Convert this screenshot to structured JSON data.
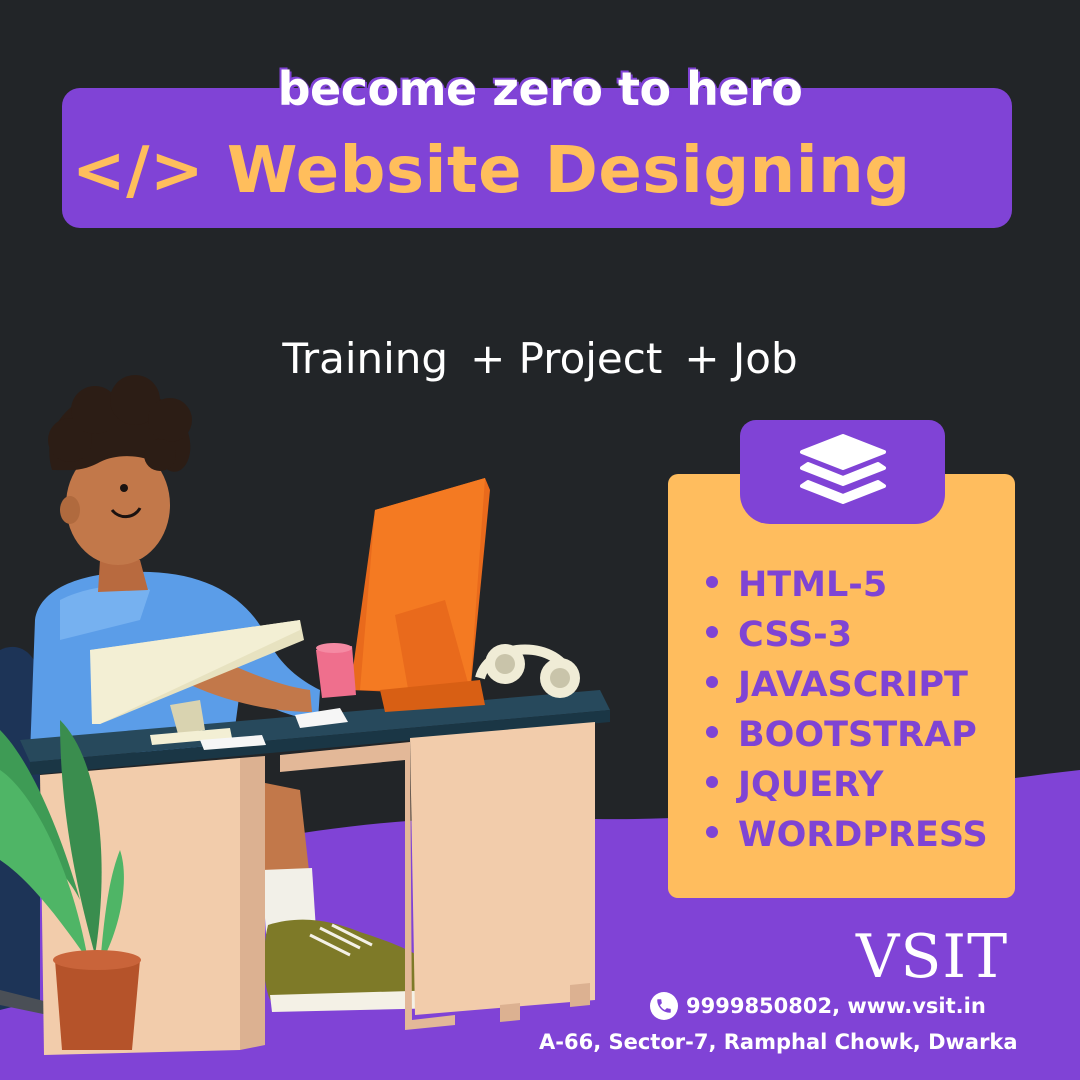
{
  "colors": {
    "background": "#222528",
    "accent_purple": "#8043d6",
    "accent_orange": "#ffbd5e",
    "text_white": "#ffffff"
  },
  "header": {
    "tagline": "become zero to hero",
    "title": "</> Website Designing"
  },
  "subtitle": {
    "part1": "Training",
    "part2": "+ Project",
    "part3": "+ Job"
  },
  "skills": {
    "icon": "layers-icon",
    "items": [
      "HTML-5",
      "CSS-3",
      "JAVASCRIPT",
      "BOOTSTRAP",
      "JQUERY",
      "WORDPRESS"
    ]
  },
  "footer": {
    "brand": "VSIT",
    "phone_icon": "phone-icon",
    "contact": "9999850802, www.vsit.in",
    "address": "A-66, Sector-7, Ramphal Chowk, Dwarka"
  },
  "illustration": {
    "subject": "person-at-computer-desk"
  }
}
